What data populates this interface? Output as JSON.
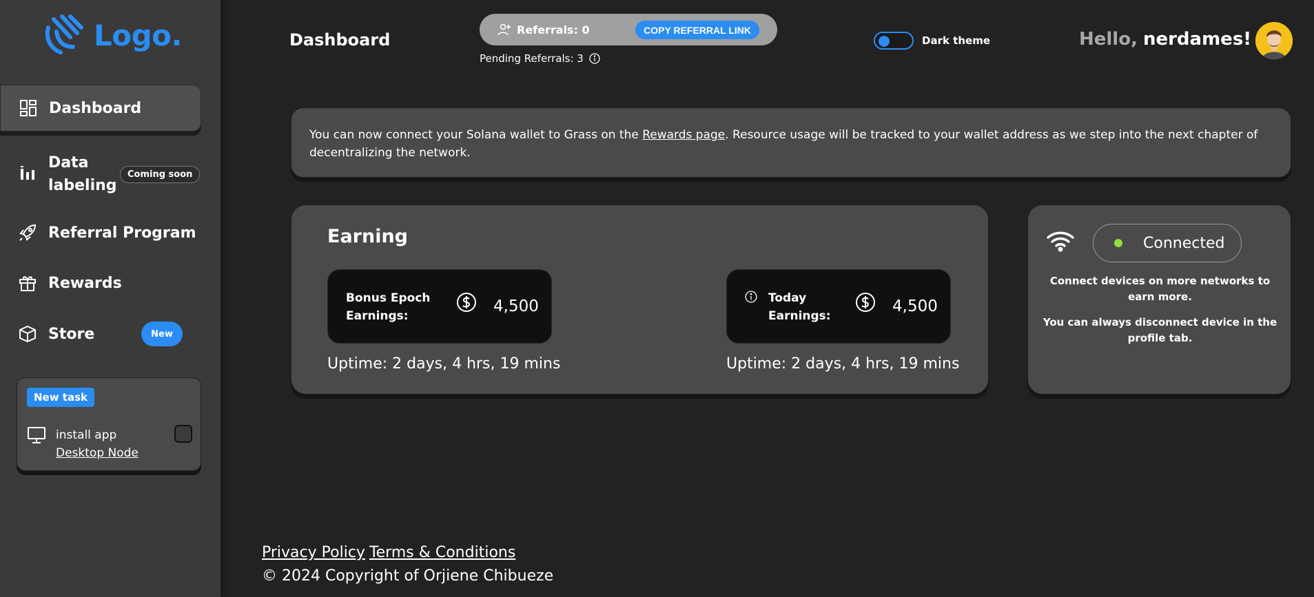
{
  "brand": {
    "logo_text": "Logo.",
    "accent": "#2b8cf2"
  },
  "sidebar": {
    "items": [
      {
        "label": "Dashboard",
        "icon": "dashboard-icon",
        "active": true
      },
      {
        "label": "Data labeling",
        "icon": "bar-chart-icon",
        "badge": "Coming soon"
      },
      {
        "label": "Referral Program",
        "icon": "rocket-icon"
      },
      {
        "label": "Rewards",
        "icon": "gift-icon"
      },
      {
        "label": "Store",
        "icon": "box-icon",
        "badge": "New"
      }
    ],
    "task": {
      "tag": "New task",
      "line1": "install app",
      "link": "Desktop Node",
      "icon": "monitor-icon",
      "checked": false
    }
  },
  "header": {
    "title": "Dashboard",
    "referrals": "Referrals: 0",
    "copy_button": "COPY REFERRAL LINK",
    "pending": "Pending Referrals: 3",
    "theme_label": "Dark theme",
    "theme_on": true,
    "greeting": "Hello,",
    "username": "nerdames!"
  },
  "banner": {
    "text_before": "You can now connect your Solana wallet to Grass on the ",
    "link": "Rewards page",
    "text_after": ". Resource usage will be tracked to your wallet address as we step into the next chapter of decentralizing the network."
  },
  "earning": {
    "title": "Earning",
    "cards": [
      {
        "label_line1": "Bonus Epoch",
        "label_line2": "Earnings:",
        "value": "4,500",
        "uptime": "Uptime: 2 days, 4 hrs, 19 mins"
      },
      {
        "label_line1": "Today",
        "label_line2": "Earnings:",
        "value": "4,500",
        "uptime": "Uptime: 2 days, 4 hrs, 19 mins"
      }
    ]
  },
  "connection": {
    "status": "Connected",
    "status_color": "#8fe03a",
    "note1": "Connect devices on more networks to earn more.",
    "note2": "You can always disconnect device in the profile tab."
  },
  "footer": {
    "privacy": "Privacy Policy",
    "terms": "Terms & Conditions",
    "copyright": "© 2024 Copyright of Orjiene Chibueze"
  }
}
